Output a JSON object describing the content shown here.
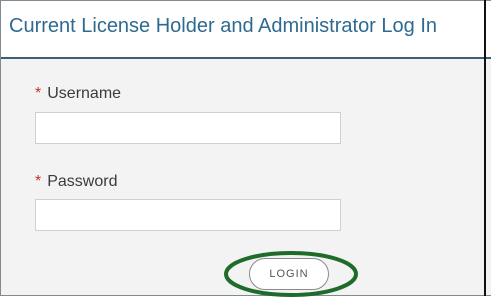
{
  "header": {
    "title": "Current License Holder and Administrator Log In"
  },
  "form": {
    "username": {
      "required_marker": "*",
      "label": "Username",
      "value": "",
      "placeholder": ""
    },
    "password": {
      "required_marker": "*",
      "label": "Password",
      "value": "",
      "placeholder": ""
    },
    "login_label": "LOGIN"
  },
  "colors": {
    "title_blue": "#2e6a91",
    "required_red": "#c0392b",
    "annotation_green": "#1e6b2a",
    "header_rule": "#3a5f78"
  }
}
